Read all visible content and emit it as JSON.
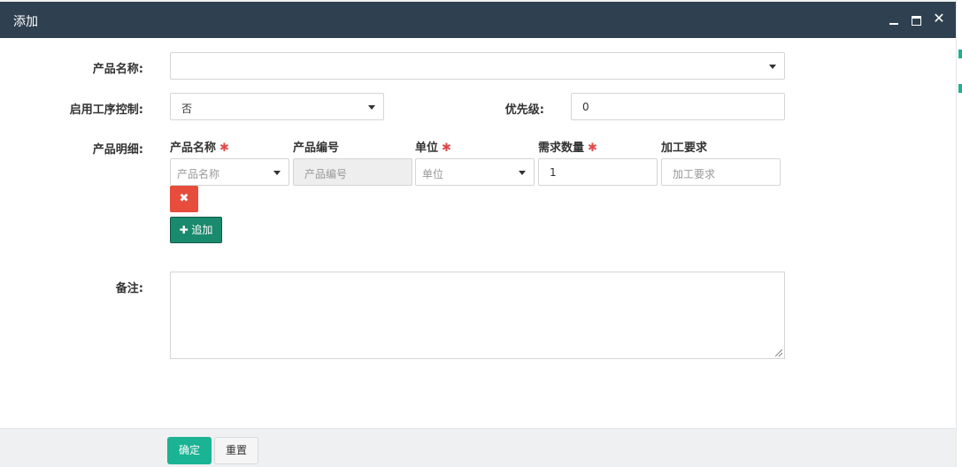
{
  "dialog": {
    "title": "添加",
    "close_glyph": "✕"
  },
  "form": {
    "product_name_label": "产品名称:",
    "product_name_value": "",
    "process_control_label": "启用工序控制:",
    "process_control_value": "否",
    "priority_label": "优先级:",
    "priority_value": "0",
    "details_label": "产品明细:",
    "remarks_label": "备注:",
    "remarks_value": ""
  },
  "details": {
    "columns": [
      {
        "label": "产品名称",
        "required": true
      },
      {
        "label": "产品编号",
        "required": false
      },
      {
        "label": "单位",
        "required": true
      },
      {
        "label": "需求数量",
        "required": true
      },
      {
        "label": "加工要求",
        "required": false
      }
    ],
    "required_mark": "✱",
    "row": {
      "product_name_placeholder": "产品名称",
      "product_code_placeholder": "产品编号",
      "unit_placeholder": "单位",
      "quantity_value": "1",
      "processing_placeholder": "加工要求"
    },
    "remove_glyph": "✖",
    "add_label": "✚ 追加"
  },
  "footer": {
    "confirm_label": "确定",
    "reset_label": "重置"
  },
  "colors": {
    "titlebar": "#2f4050",
    "primary": "#1ab394",
    "danger": "#e74c3c",
    "add_button": "#1a8a6e"
  }
}
